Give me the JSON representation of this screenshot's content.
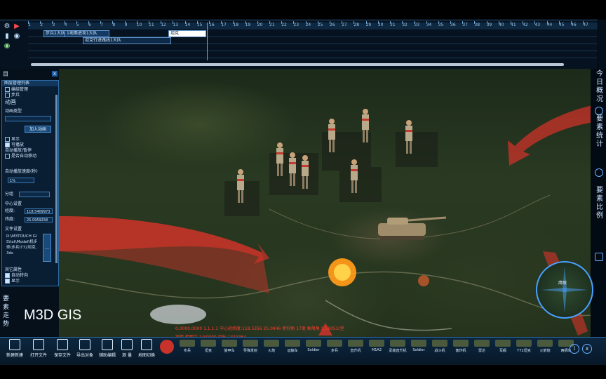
{
  "timeline": {
    "ticks": [
      "1",
      "2",
      "3",
      "4",
      "5",
      "6",
      "7",
      "8",
      "9",
      "10",
      "11",
      "12",
      "13",
      "14",
      "15",
      "16",
      "17",
      "18",
      "19",
      "20",
      "21",
      "22",
      "23",
      "24",
      "25",
      "26",
      "27",
      "28",
      "29",
      "30",
      "31",
      "32",
      "33",
      "34",
      "35",
      "36",
      "37",
      "38",
      "39",
      "40",
      "41",
      "42",
      "43",
      "44",
      "45",
      "46",
      "47"
    ],
    "clips": [
      "步兵1大队",
      "1地面进攻1大队",
      "坦克",
      "坦克行进路线1大队"
    ]
  },
  "left_panel": {
    "header": "图层管理列表",
    "item1": "编组管理",
    "item2": "步兵",
    "section_anim": "动画",
    "anim_type_label": "动画类型",
    "anim_type_value": "",
    "add_anim_button": "加入动画",
    "visible_label": "显示",
    "play_label": "可播放",
    "auto_move_label": "自动播放/暂停",
    "follow_label": "是否自动移动",
    "auto_speed_label": "自动播放速度(秒)",
    "speed_value": "1%",
    "group_label": "分组",
    "center_label": "中心设置",
    "lon_label": "经度:",
    "lon_value": "118.5409973",
    "lat_label": "纬度:",
    "lat_value": "25.0959258",
    "file_label": "文件设置",
    "file_path": "D:\\M3TOUCH GIS\\txt\\Model\\机步师\\步兵\\T72坦克.3ds",
    "extra_label": "其它属性",
    "auto_turn_label": "自动转向",
    "show_label": "显示"
  },
  "right_tabs": {
    "tab1": "今日概况",
    "tab2": "要素统计",
    "tab3": "要素比例"
  },
  "brand": "M3D GIS",
  "left_vertical_text": "要素走势",
  "status_line1": "0.0000.0000    1.1.1.1  中心经纬度:118.5356 25.0946 俯仰角 17度 象限角:1.5605公里",
  "status_line2": "测距 相距比 1:50000 坐标 1343364",
  "bottom_tools": [
    {
      "name": "new-button",
      "label": "新建新建"
    },
    {
      "name": "open-file-button",
      "label": "打开文件"
    },
    {
      "name": "save-file-button",
      "label": "保存文件"
    },
    {
      "name": "import-button",
      "label": "导出对象"
    },
    {
      "name": "assist-button",
      "label": "辅助编辑"
    },
    {
      "name": "record-button",
      "label": "测 量"
    },
    {
      "name": "terrain-button",
      "label": "地图切换"
    }
  ],
  "assets": [
    "布兵",
    "坦克",
    "装甲车",
    "导弹发射",
    "火炮",
    "运输车",
    "Soldier",
    "步兵",
    "直升机",
    "M1A2",
    "武装直升机",
    "Soldier",
    "战斗机",
    "轰炸机",
    "雷达",
    "军舰",
    "T72坦克",
    "火箭炮",
    "两栖车"
  ],
  "minimap": {
    "label": "鹰眼"
  },
  "colors": {
    "accent": "#2e6ca8",
    "status": "#ff3b2e",
    "arrow": "#d8322a"
  }
}
